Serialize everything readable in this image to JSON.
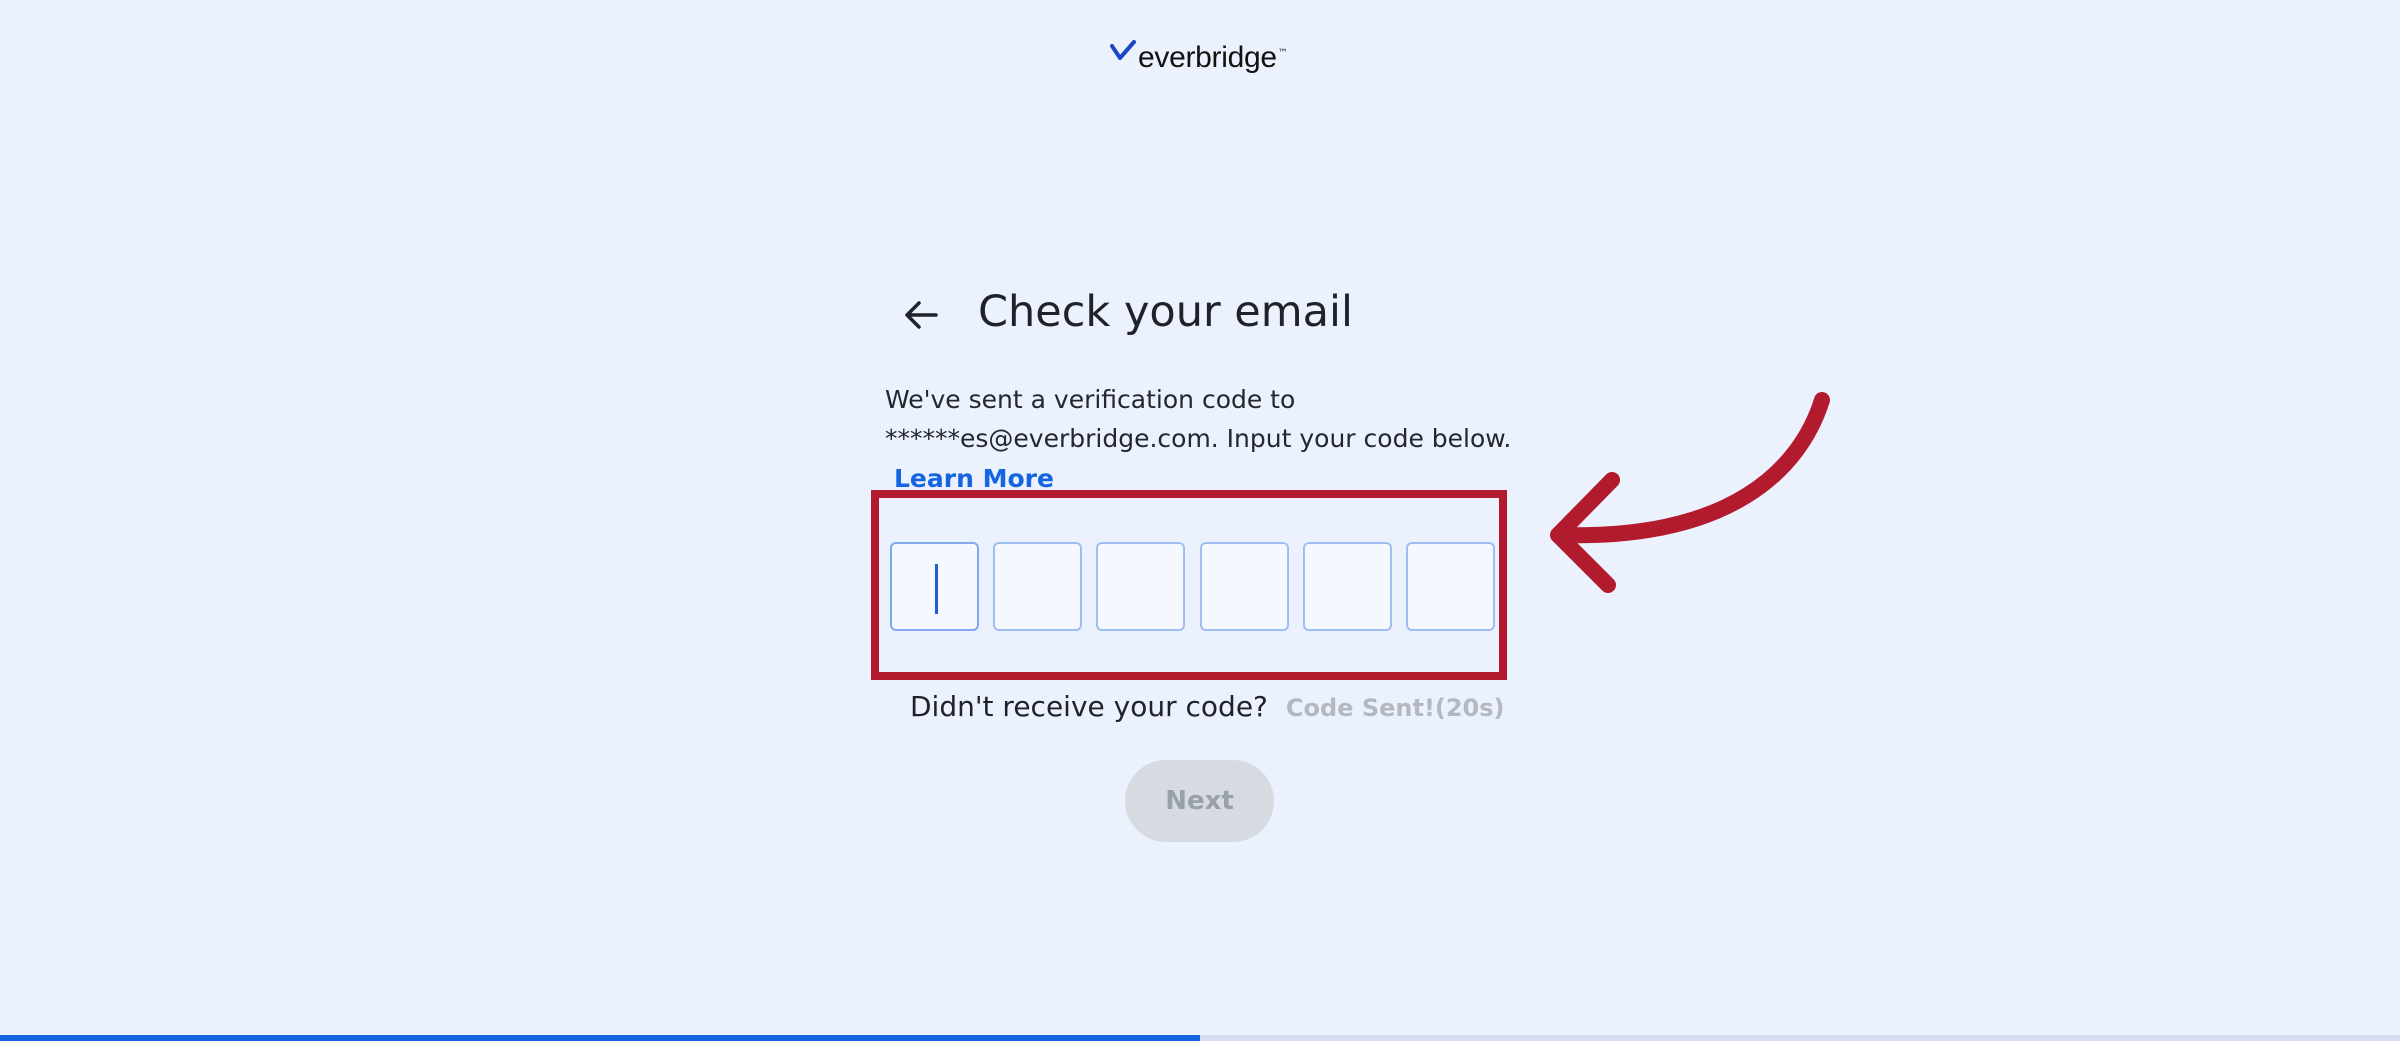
{
  "brand": {
    "name": "everbridge",
    "mark": "™",
    "logo_icon": "everbridge-swoosh-icon",
    "accent_color": "#1565e0",
    "annotation_color": "#b21a2e"
  },
  "header": {
    "back_icon": "arrow-left-icon",
    "title": "Check your email"
  },
  "message": {
    "line1": "We've sent a verification code to",
    "line2": "******es@everbridge.com. Input your code below.",
    "learn_more": "Learn More"
  },
  "code_input": {
    "length": 6,
    "digits": [
      "",
      "",
      "",
      "",
      "",
      ""
    ],
    "active_index": 0
  },
  "resend": {
    "question": "Didn't receive your code?",
    "status": "Code Sent!(20s)"
  },
  "actions": {
    "next_label": "Next",
    "next_enabled": false
  },
  "progress": {
    "fraction": 0.5
  },
  "annotation": {
    "type": "highlight-box-with-curved-arrow",
    "icon": "curved-arrow-icon"
  }
}
